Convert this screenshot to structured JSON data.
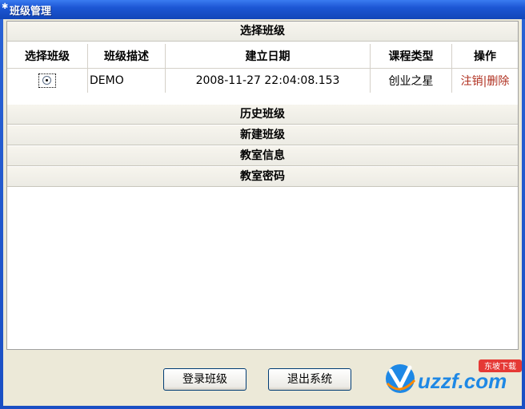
{
  "window": {
    "title": "班级管理"
  },
  "sections": {
    "select_class": "选择班级",
    "history_class": "历史班级",
    "new_class": "新建班级",
    "classroom_info": "教室信息",
    "classroom_password": "教室密码"
  },
  "table": {
    "headers": [
      "选择班级",
      "班级描述",
      "建立日期",
      "课程类型",
      "操作"
    ],
    "rows": [
      {
        "description": "DEMO",
        "created": "2008-11-27 22:04:08.153",
        "course_type": "创业之星",
        "action_logout": "注销",
        "action_sep": "|",
        "action_delete": "删除"
      }
    ]
  },
  "buttons": {
    "login": "登录班级",
    "exit": "退出系统"
  },
  "watermark": {
    "text": "uzzf.com",
    "tag": "东坡下载"
  }
}
